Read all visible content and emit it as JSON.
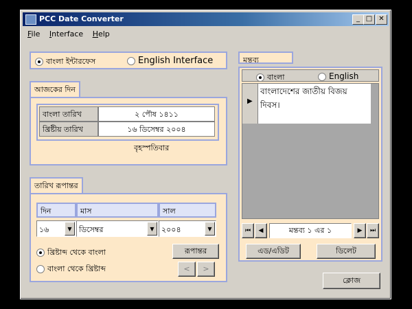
{
  "window": {
    "title": "PCC Date Converter",
    "buttons": {
      "minimize": "_",
      "maximize": "□",
      "close": "✕"
    }
  },
  "menu": [
    "File",
    "Interface",
    "Help"
  ],
  "interface": {
    "bangla_label": "বাংলা ইন্টারফেস",
    "english_label": "English Interface",
    "selected": "bangla"
  },
  "today": {
    "tab": "আজকের দিন",
    "bangla_date_label": "বাংলা তারিখ",
    "bangla_date_value": "২ পৌষ ১৪১১",
    "english_date_label": "খ্রিষ্টীয় তারিখ",
    "english_date_value": "১৬ ডিসেম্বর ২০০৪",
    "weekday": "বৃহস্পতিবার"
  },
  "convert": {
    "tab": "তারিখ রূপান্তর",
    "day_header": "দিন",
    "month_header": "মাস",
    "year_header": "সাল",
    "day_value": "১৬",
    "month_value": "ডিসেম্বর",
    "year_value": "২০০৪",
    "option1": "খ্রিষ্টাব্দ থেকে বাংলা",
    "option2": "বাংলা থেকে খ্রিষ্টাব্দ",
    "convert_button": "রূপান্তর",
    "prev": "<",
    "next": ">"
  },
  "comment": {
    "tab": "মন্তব্য",
    "lang_bangla": "বাংলা",
    "lang_english": "English",
    "text": "বাংলাদেশের জাতীয় বিজয় দিবস।",
    "record": "মন্তব্য ১ এর ১",
    "add_edit_button": "এড/এডিট",
    "delete_button": "ডিলেট"
  },
  "close_button": "ক্লোজ"
}
